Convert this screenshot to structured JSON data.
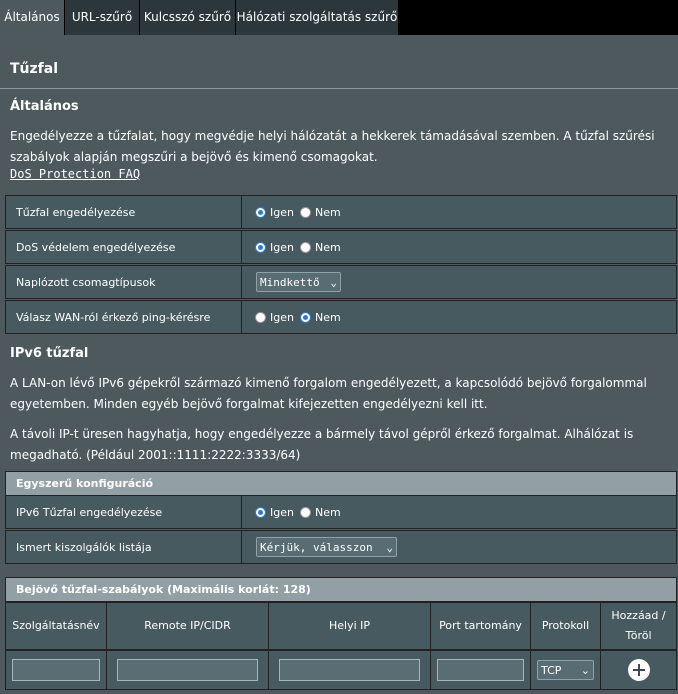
{
  "tabs": [
    "Általános",
    "URL-szűrő",
    "Kulcsszó szűrő",
    "Hálózati szolgáltatás szűrő"
  ],
  "page_title": "Tűzfal",
  "general": {
    "heading": "Általános",
    "description": "Engedélyezze a tűzfalat, hogy megvédje helyi hálózatát a hekkerek támadásával szemben. A tűzfal szűrési szabályok alapján megszűri a bejövő és kimenő csomagokat.",
    "faq_link": "DoS Protection FAQ",
    "rows": [
      {
        "label": "Tűzfal engedélyezése",
        "yes": "Igen",
        "no": "Nem",
        "selected": "yes"
      },
      {
        "label": "DoS védelem engedélyezése",
        "yes": "Igen",
        "no": "Nem",
        "selected": "yes"
      },
      {
        "label": "Naplózott csomagtípusok",
        "select_value": "Mindkettő"
      },
      {
        "label": "Válasz WAN-ról érkező ping-kérésre",
        "yes": "Igen",
        "no": "Nem",
        "selected": "no"
      }
    ]
  },
  "ipv6": {
    "heading": "IPv6 tűzfal",
    "desc1": "A LAN-on lévő IPv6 gépekről származó kimenő forgalom engedélyezett, a kapcsolódó bejövő forgalommal egyetemben. Minden egyéb bejövő forgalmat kifejezetten engedélyezni kell itt.",
    "desc2": "A távoli IP-t üresen hagyhatja, hogy engedélyezze a bármely távol gépről érkező forgalmat. Alhálózat is megadható. (Például 2001::1111:2222:3333/64)",
    "simple_config": {
      "header": "Egyszerű konfiguráció",
      "enable_label": "IPv6 Tűzfal engedélyezése",
      "yes": "Igen",
      "no": "Nem",
      "selected": "yes",
      "servers_label": "Ismert kiszolgálók listája",
      "servers_select": "Kérjük, válasszon"
    },
    "inbound": {
      "header": "Bejövő tűzfal-szabályok (Maximális korlát: 128)",
      "columns": [
        "Szolgáltatásnév",
        "Remote IP/CIDR",
        "Helyi IP",
        "Port tartomány",
        "Protokoll",
        "Hozzáad / Töröl"
      ],
      "protocol_value": "TCP"
    }
  }
}
